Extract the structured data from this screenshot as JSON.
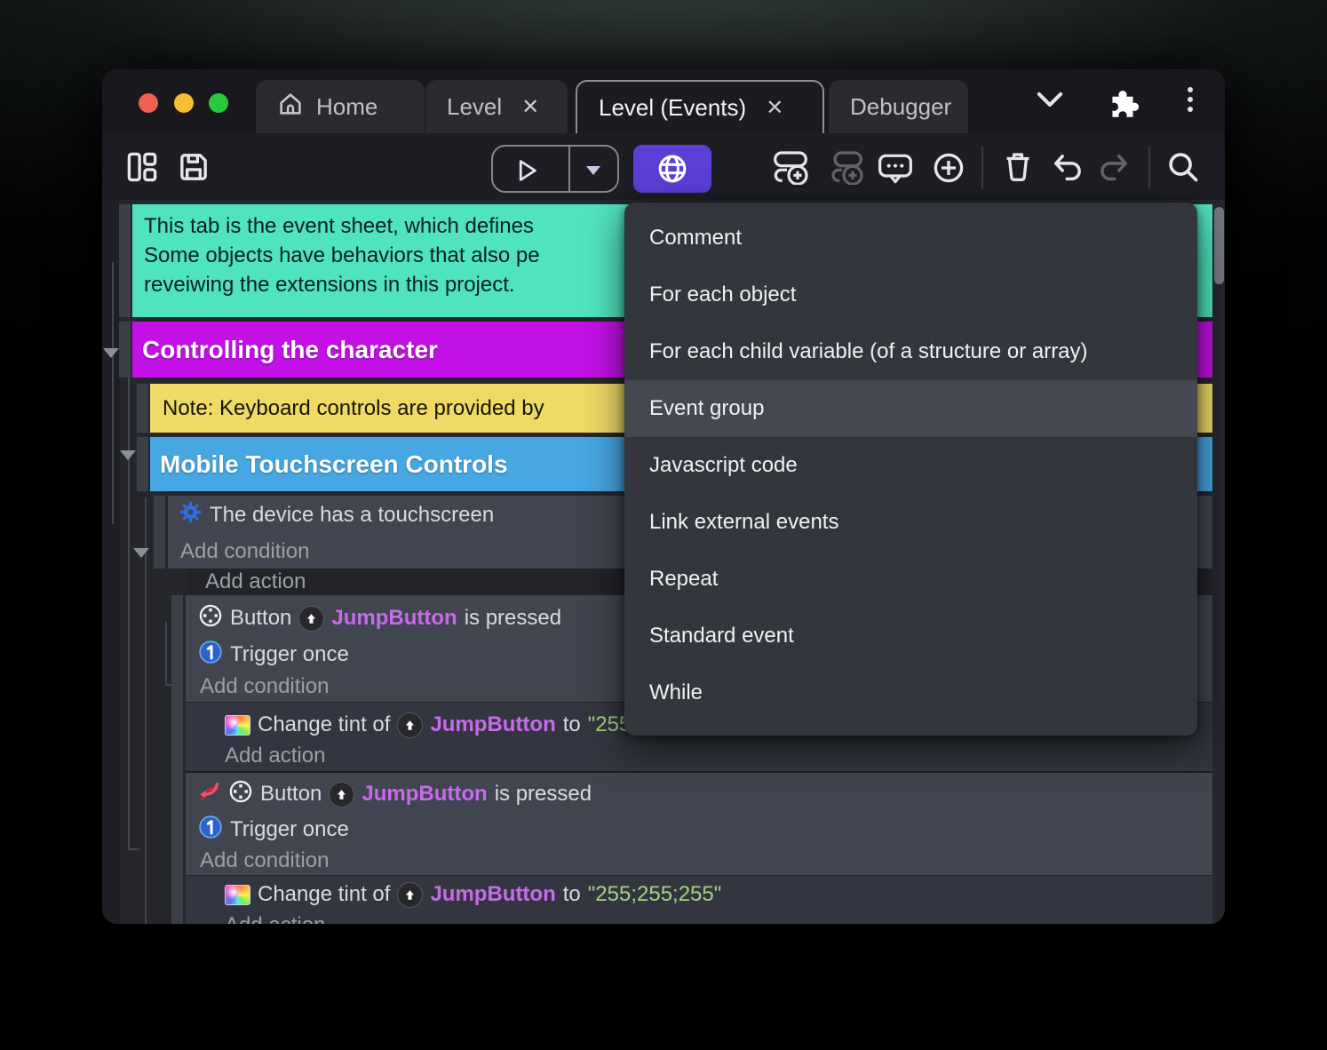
{
  "window": {
    "title_tabs": [
      {
        "label": "Home"
      },
      {
        "label": "Level"
      },
      {
        "label": "Level (Events)"
      },
      {
        "label": "Debugger"
      }
    ],
    "close_glyph": "✕",
    "traffic_lights": {
      "red": "#ef5f52",
      "yellow": "#f6be30",
      "green": "#27c93f"
    }
  },
  "toolbar": {
    "icons": [
      "layout-panels-icon",
      "save-icon",
      "play-icon",
      "play-dropdown-caret",
      "globe-preview-icon",
      "add-event-icon",
      "add-subevent-icon",
      "add-comment-icon",
      "add-plus-icon",
      "delete-icon",
      "undo-icon",
      "redo-icon",
      "search-icon"
    ]
  },
  "titlebar_icons": [
    "home-icon",
    "chevron-down-icon",
    "puzzle-addon-icon",
    "kebab-menu-icon"
  ],
  "menu": {
    "items": [
      "Comment",
      "For each object",
      "For each child variable (of a structure or array)",
      "Event group",
      "Javascript code",
      "Link external events",
      "Repeat",
      "Standard event",
      "While"
    ],
    "highlighted_item": "Event group"
  },
  "sheet": {
    "comment": {
      "lines": [
        "This tab is the event sheet, which defines",
        "Some objects have behaviors that also pe",
        "reveiwing the extensions in this project."
      ]
    },
    "groups": {
      "controlling": "Controlling the character",
      "mobile": "Mobile Touchscreen Controls"
    },
    "note": "Note: Keyboard controls are provided by",
    "labels": {
      "add_condition": "Add condition",
      "add_action": "Add action"
    },
    "touch_condition": "The device has a touchscreen",
    "button_event": {
      "object": "Button",
      "instance": "JumpButton",
      "predicate": "is pressed",
      "trigger": "Trigger once"
    },
    "tint_action": {
      "prefix": "Change tint of",
      "instance": "JumpButton",
      "connector": "to",
      "value": "\"255;255;255\""
    }
  },
  "colors": {
    "accent_purple": "#5b3fd6",
    "comment_teal": "#50e3c2",
    "group_magenta": "#c311e6",
    "note_yellow": "#efda66",
    "header_blue": "#46a7e3",
    "object_magenta": "#c76aeb",
    "string_green": "#a3d47c",
    "menu_bg": "#34363d",
    "menu_highlight": "#454851"
  }
}
